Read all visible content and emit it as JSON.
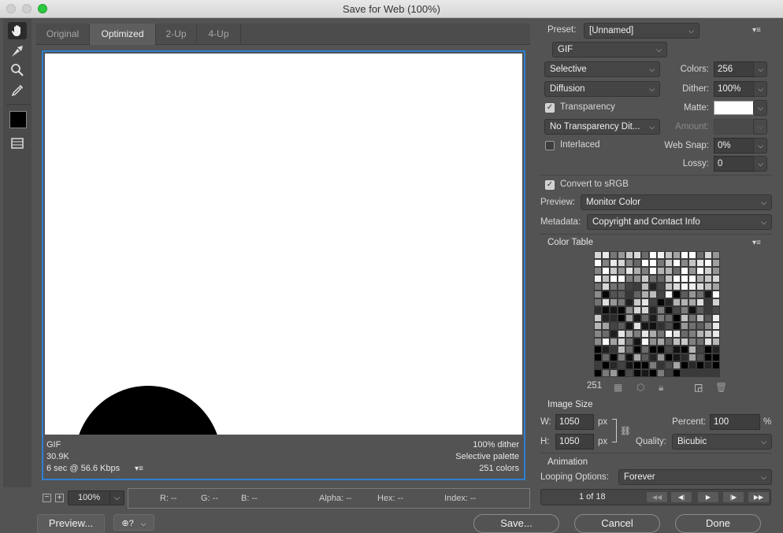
{
  "window": {
    "title": "Save for Web (100%)"
  },
  "tabs": [
    {
      "label": "Original",
      "active": false
    },
    {
      "label": "Optimized",
      "active": true
    },
    {
      "label": "2-Up",
      "active": false
    },
    {
      "label": "4-Up",
      "active": false
    }
  ],
  "tools": [
    "hand-tool-icon",
    "slice-select-tool-icon",
    "zoom-tool-icon",
    "eyedropper-tool-icon",
    "eyedropper-color-swatch",
    "toggle-slices-icon"
  ],
  "preview_info": {
    "format": "GIF",
    "size": "30.9K",
    "download": "6 sec @ 56.6 Kbps",
    "dither": "100% dither",
    "palette": "Selective palette",
    "colors": "251 colors"
  },
  "status": {
    "zoom": "100%",
    "r": "R: --",
    "g": "G: --",
    "b": "B: --",
    "alpha": "Alpha: --",
    "hex": "Hex: --",
    "index": "Index: --"
  },
  "bottom_buttons": {
    "preview": "Preview...",
    "save": "Save...",
    "cancel": "Cancel",
    "done": "Done"
  },
  "settings": {
    "preset_label": "Preset:",
    "preset": "[Unnamed]",
    "format": "GIF",
    "reduction": "Selective",
    "colors_label": "Colors:",
    "colors": "256",
    "dither_algo": "Diffusion",
    "dither_label": "Dither:",
    "dither": "100%",
    "transparency_label": "Transparency",
    "transparency": true,
    "matte_label": "Matte:",
    "matte_color": "#ffffff",
    "trans_dither": "No Transparency Dit...",
    "amount_label": "Amount:",
    "interlaced_label": "Interlaced",
    "interlaced": false,
    "websnap_label": "Web Snap:",
    "websnap": "0%",
    "lossy_label": "Lossy:",
    "lossy": "0",
    "srgb_label": "Convert to sRGB",
    "srgb": true,
    "preview_label": "Preview:",
    "preview": "Monitor Color",
    "metadata_label": "Metadata:",
    "metadata": "Copyright and Contact Info"
  },
  "color_table": {
    "title": "Color Table",
    "count": "251"
  },
  "image_size": {
    "title": "Image Size",
    "w_label": "W:",
    "w": "1050",
    "h_label": "H:",
    "h": "1050",
    "unit": "px",
    "percent_label": "Percent:",
    "percent": "100",
    "percent_unit": "%",
    "quality_label": "Quality:",
    "quality": "Bicubic"
  },
  "animation": {
    "title": "Animation",
    "looping_label": "Looping Options:",
    "looping": "Forever",
    "frame": "1 of 18"
  },
  "colors": {
    "accent": "#2f7fd0",
    "panel": "#535353"
  }
}
